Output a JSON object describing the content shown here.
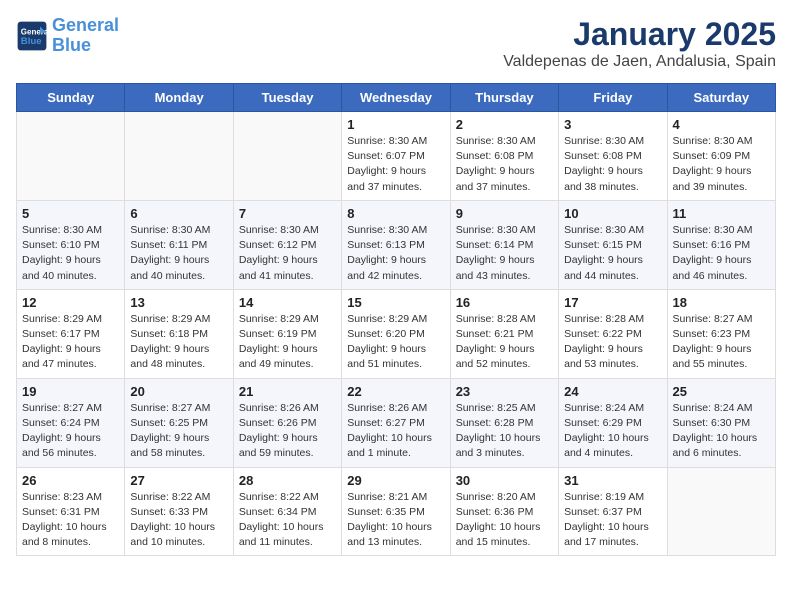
{
  "logo": {
    "line1": "General",
    "line2": "Blue"
  },
  "title": "January 2025",
  "subtitle": "Valdepenas de Jaen, Andalusia, Spain",
  "headers": [
    "Sunday",
    "Monday",
    "Tuesday",
    "Wednesday",
    "Thursday",
    "Friday",
    "Saturday"
  ],
  "weeks": [
    [
      {
        "day": "",
        "info": ""
      },
      {
        "day": "",
        "info": ""
      },
      {
        "day": "",
        "info": ""
      },
      {
        "day": "1",
        "info": "Sunrise: 8:30 AM\nSunset: 6:07 PM\nDaylight: 9 hours and 37 minutes."
      },
      {
        "day": "2",
        "info": "Sunrise: 8:30 AM\nSunset: 6:08 PM\nDaylight: 9 hours and 37 minutes."
      },
      {
        "day": "3",
        "info": "Sunrise: 8:30 AM\nSunset: 6:08 PM\nDaylight: 9 hours and 38 minutes."
      },
      {
        "day": "4",
        "info": "Sunrise: 8:30 AM\nSunset: 6:09 PM\nDaylight: 9 hours and 39 minutes."
      }
    ],
    [
      {
        "day": "5",
        "info": "Sunrise: 8:30 AM\nSunset: 6:10 PM\nDaylight: 9 hours and 40 minutes."
      },
      {
        "day": "6",
        "info": "Sunrise: 8:30 AM\nSunset: 6:11 PM\nDaylight: 9 hours and 40 minutes."
      },
      {
        "day": "7",
        "info": "Sunrise: 8:30 AM\nSunset: 6:12 PM\nDaylight: 9 hours and 41 minutes."
      },
      {
        "day": "8",
        "info": "Sunrise: 8:30 AM\nSunset: 6:13 PM\nDaylight: 9 hours and 42 minutes."
      },
      {
        "day": "9",
        "info": "Sunrise: 8:30 AM\nSunset: 6:14 PM\nDaylight: 9 hours and 43 minutes."
      },
      {
        "day": "10",
        "info": "Sunrise: 8:30 AM\nSunset: 6:15 PM\nDaylight: 9 hours and 44 minutes."
      },
      {
        "day": "11",
        "info": "Sunrise: 8:30 AM\nSunset: 6:16 PM\nDaylight: 9 hours and 46 minutes."
      }
    ],
    [
      {
        "day": "12",
        "info": "Sunrise: 8:29 AM\nSunset: 6:17 PM\nDaylight: 9 hours and 47 minutes."
      },
      {
        "day": "13",
        "info": "Sunrise: 8:29 AM\nSunset: 6:18 PM\nDaylight: 9 hours and 48 minutes."
      },
      {
        "day": "14",
        "info": "Sunrise: 8:29 AM\nSunset: 6:19 PM\nDaylight: 9 hours and 49 minutes."
      },
      {
        "day": "15",
        "info": "Sunrise: 8:29 AM\nSunset: 6:20 PM\nDaylight: 9 hours and 51 minutes."
      },
      {
        "day": "16",
        "info": "Sunrise: 8:28 AM\nSunset: 6:21 PM\nDaylight: 9 hours and 52 minutes."
      },
      {
        "day": "17",
        "info": "Sunrise: 8:28 AM\nSunset: 6:22 PM\nDaylight: 9 hours and 53 minutes."
      },
      {
        "day": "18",
        "info": "Sunrise: 8:27 AM\nSunset: 6:23 PM\nDaylight: 9 hours and 55 minutes."
      }
    ],
    [
      {
        "day": "19",
        "info": "Sunrise: 8:27 AM\nSunset: 6:24 PM\nDaylight: 9 hours and 56 minutes."
      },
      {
        "day": "20",
        "info": "Sunrise: 8:27 AM\nSunset: 6:25 PM\nDaylight: 9 hours and 58 minutes."
      },
      {
        "day": "21",
        "info": "Sunrise: 8:26 AM\nSunset: 6:26 PM\nDaylight: 9 hours and 59 minutes."
      },
      {
        "day": "22",
        "info": "Sunrise: 8:26 AM\nSunset: 6:27 PM\nDaylight: 10 hours and 1 minute."
      },
      {
        "day": "23",
        "info": "Sunrise: 8:25 AM\nSunset: 6:28 PM\nDaylight: 10 hours and 3 minutes."
      },
      {
        "day": "24",
        "info": "Sunrise: 8:24 AM\nSunset: 6:29 PM\nDaylight: 10 hours and 4 minutes."
      },
      {
        "day": "25",
        "info": "Sunrise: 8:24 AM\nSunset: 6:30 PM\nDaylight: 10 hours and 6 minutes."
      }
    ],
    [
      {
        "day": "26",
        "info": "Sunrise: 8:23 AM\nSunset: 6:31 PM\nDaylight: 10 hours and 8 minutes."
      },
      {
        "day": "27",
        "info": "Sunrise: 8:22 AM\nSunset: 6:33 PM\nDaylight: 10 hours and 10 minutes."
      },
      {
        "day": "28",
        "info": "Sunrise: 8:22 AM\nSunset: 6:34 PM\nDaylight: 10 hours and 11 minutes."
      },
      {
        "day": "29",
        "info": "Sunrise: 8:21 AM\nSunset: 6:35 PM\nDaylight: 10 hours and 13 minutes."
      },
      {
        "day": "30",
        "info": "Sunrise: 8:20 AM\nSunset: 6:36 PM\nDaylight: 10 hours and 15 minutes."
      },
      {
        "day": "31",
        "info": "Sunrise: 8:19 AM\nSunset: 6:37 PM\nDaylight: 10 hours and 17 minutes."
      },
      {
        "day": "",
        "info": ""
      }
    ]
  ]
}
